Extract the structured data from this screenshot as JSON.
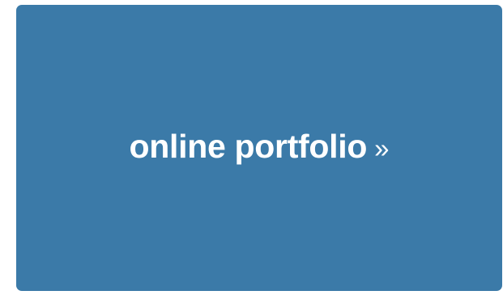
{
  "portfolio_button": {
    "label": "online portfolio",
    "arrow": "»",
    "background_color": "#3b7aa8",
    "text_color": "#ffffff",
    "arrow_icon": "double-chevron-right-icon"
  }
}
